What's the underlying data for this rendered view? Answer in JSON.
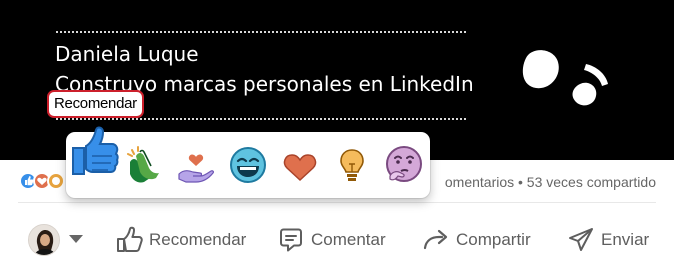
{
  "post_media": {
    "author_name": "Daniela Luque",
    "author_tagline": "Construyo marcas personales en LinkedIn"
  },
  "tooltip": {
    "label": "Recomendar"
  },
  "reaction_picker": {
    "reactions": [
      "like-icon",
      "celebrate-icon",
      "support-icon",
      "funny-icon",
      "love-icon",
      "insightful-icon",
      "curious-icon"
    ]
  },
  "social_counts": {
    "text": "omentarios • 53 veces compartido"
  },
  "actions": {
    "like_label": "Recomendar",
    "comment_label": "Comentar",
    "share_label": "Compartir",
    "send_label": "Enviar"
  },
  "colors": {
    "like_blue": "#378fe9",
    "tooltip_border": "#cc1f2b",
    "action_text": "#5e5e5e"
  }
}
